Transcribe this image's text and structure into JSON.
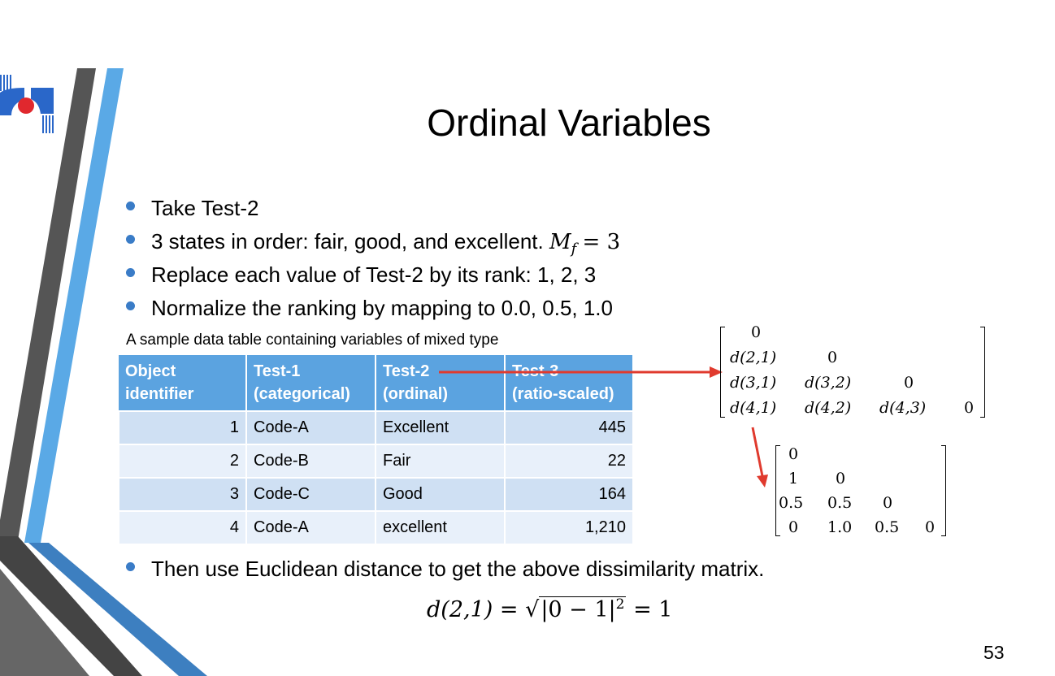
{
  "slide": {
    "title": "Ordinal Variables",
    "bullets": [
      "Take Test-2",
      "3 states in order: fair, good, and excellent.",
      "Replace each value of Test-2 by its rank: 1, 2, 3",
      "Normalize the ranking by mapping to 0.0, 0.5, 1.0"
    ],
    "mf_var": "M",
    "mf_sub": "f",
    "mf_eq": "= 3",
    "caption": "A sample data table containing variables of mixed type",
    "table": {
      "headers": [
        [
          "Object",
          "identifier"
        ],
        [
          "Test-1",
          "(categorical)"
        ],
        [
          "Test-2",
          "(ordinal)"
        ],
        [
          "Test-3",
          "(ratio-scaled)"
        ]
      ],
      "rows": [
        [
          "1",
          "Code-A",
          "Excellent",
          "445"
        ],
        [
          "2",
          "Code-B",
          "Fair",
          "22"
        ],
        [
          "3",
          "Code-C",
          "Good",
          "164"
        ],
        [
          "4",
          "Code-A",
          "excellent",
          "1,210"
        ]
      ]
    },
    "matrix_symbolic": [
      [
        "0"
      ],
      [
        "d(2,1)",
        "0"
      ],
      [
        "d(3,1)",
        "d(3,2)",
        "0"
      ],
      [
        "d(4,1)",
        "d(4,2)",
        "d(4,3)",
        "0"
      ]
    ],
    "matrix_numeric": [
      [
        "0"
      ],
      [
        "1",
        "0"
      ],
      [
        "0.5",
        "0.5",
        "0"
      ],
      [
        "0",
        "1.0",
        "0.5",
        "0"
      ]
    ],
    "final_bullet": "Then use Euclidean distance to get the above dissimilarity matrix.",
    "formula": {
      "lhs": "d(2,1) =",
      "radicand": "|0 − 1|",
      "exp": "2",
      "rhs": "= 1"
    },
    "page_number": "53",
    "colors": {
      "accent_blue": "#5ba3e0",
      "bullet_blue": "#3a7cc7",
      "arrow_red": "#e03a2e",
      "dark_stripe": "#555555"
    }
  }
}
